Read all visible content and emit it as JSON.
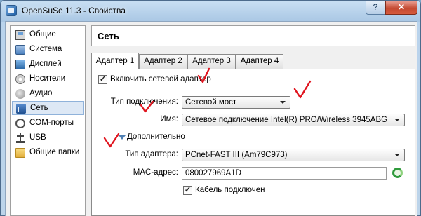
{
  "window": {
    "title": "OpenSuSe 11.3 - Свойства",
    "help_glyph": "?",
    "close_glyph": "✕"
  },
  "sidebar": {
    "items": [
      {
        "label": "Общие",
        "icon": "general-icon"
      },
      {
        "label": "Система",
        "icon": "system-icon"
      },
      {
        "label": "Дисплей",
        "icon": "display-icon"
      },
      {
        "label": "Носители",
        "icon": "storage-icon"
      },
      {
        "label": "Аудио",
        "icon": "audio-icon"
      },
      {
        "label": "Сеть",
        "icon": "network-icon",
        "selected": true
      },
      {
        "label": "COM-порты",
        "icon": "com-port-icon"
      },
      {
        "label": "USB",
        "icon": "usb-icon"
      },
      {
        "label": "Общие папки",
        "icon": "shared-folder-icon"
      }
    ]
  },
  "page": {
    "title": "Сеть"
  },
  "tabs": [
    {
      "label": "Адаптер 1",
      "active": true
    },
    {
      "label": "Адаптер 2"
    },
    {
      "label": "Адаптер 3"
    },
    {
      "label": "Адаптер 4"
    }
  ],
  "adapter": {
    "enable_label": "Включить сетевой адаптер",
    "enable_checked": true,
    "connection_type_label": "Тип подключения:",
    "connection_type_value": "Сетевой мост",
    "name_label": "Имя:",
    "name_value": "Сетевое подключение Intel(R) PRO/Wireless 3945ABG",
    "advanced_label": "Дополнительно",
    "adapter_type_label": "Тип адаптера:",
    "adapter_type_value": "PCnet-FAST III (Am79C973)",
    "mac_label": "MAC-адрес:",
    "mac_value": "080027969A1D",
    "cable_label": "Кабель подключен",
    "cable_checked": true
  },
  "annotation_color": "#e0141e",
  "checkbox_glyph": "✓"
}
